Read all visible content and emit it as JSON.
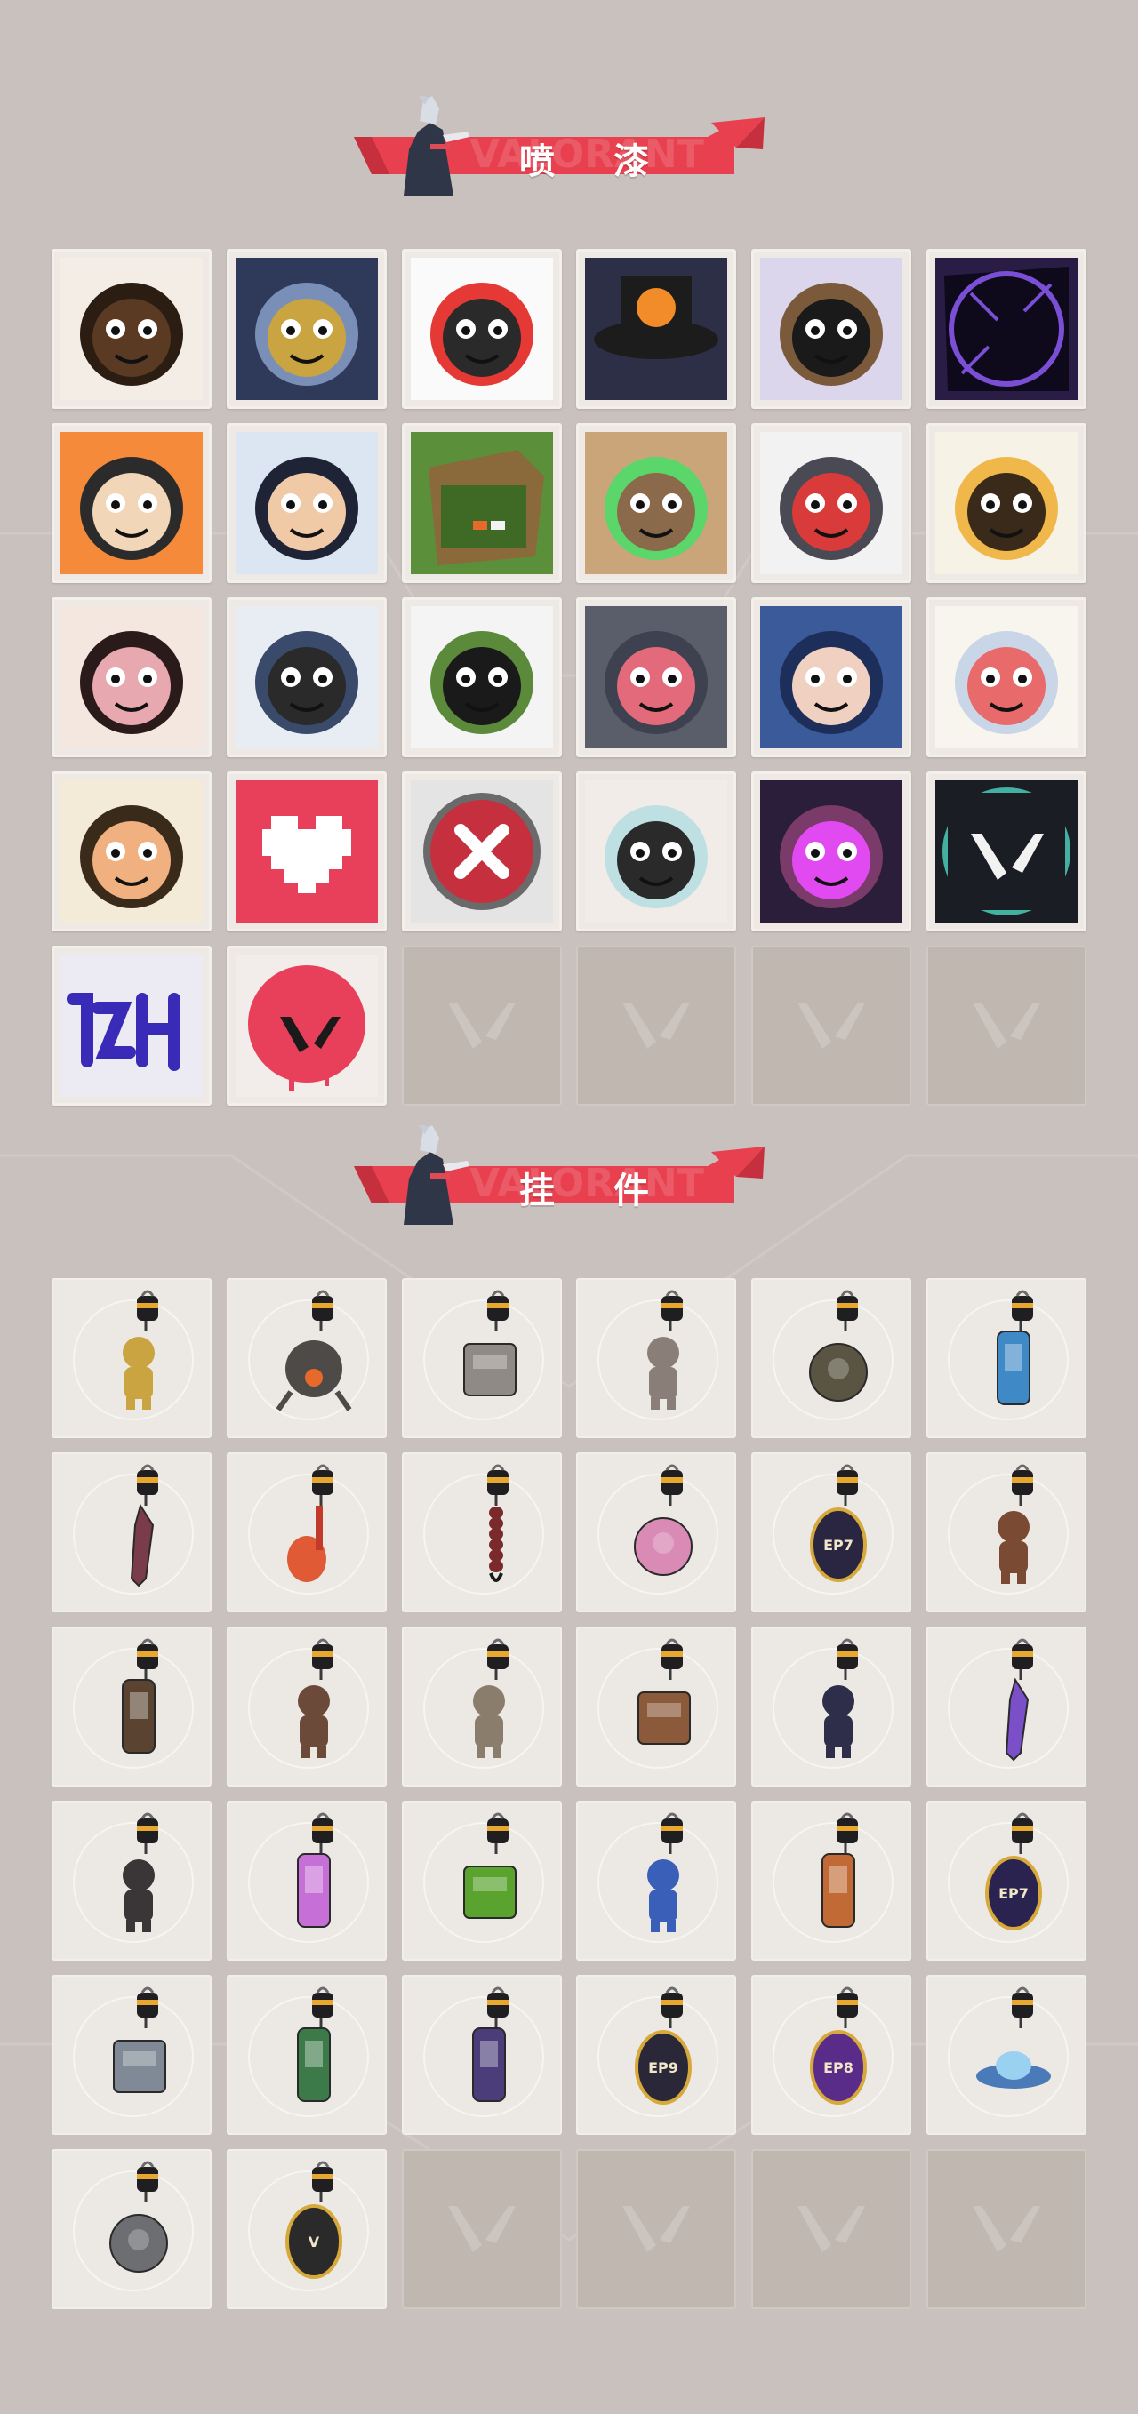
{
  "sections": {
    "sprays": {
      "title": "喷 漆"
    },
    "buddies": {
      "title": "挂 件"
    }
  },
  "banner": {
    "watermark": "VALORANT",
    "accent_color": "#e8404f",
    "accent_dark": "#c62f3e"
  },
  "sprays": [
    {
      "name": "pixel-mohawk-agent-spray",
      "kind": "spray"
    },
    {
      "name": "helmet-robot-spray",
      "kind": "spray"
    },
    {
      "name": "clown-face-spray",
      "kind": "spray"
    },
    {
      "name": "top-hat-spray",
      "kind": "spray"
    },
    {
      "name": "sunglasses-raccoon-spray",
      "kind": "spray"
    },
    {
      "name": "dark-portal-spray",
      "kind": "spray"
    },
    {
      "name": "grinning-bearded-agent-spray",
      "kind": "spray"
    },
    {
      "name": "bandaged-boy-spray",
      "kind": "spray"
    },
    {
      "name": "green-crate-spray",
      "kind": "spray"
    },
    {
      "name": "glowing-eyes-creature-spray",
      "kind": "spray"
    },
    {
      "name": "crying-seal-spray",
      "kind": "spray"
    },
    {
      "name": "laughing-tiger-spray",
      "kind": "spray"
    },
    {
      "name": "angry-girl-pencil-spray",
      "kind": "spray"
    },
    {
      "name": "beanie-penguin-spray",
      "kind": "spray"
    },
    {
      "name": "top-hat-frog-spray",
      "kind": "spray"
    },
    {
      "name": "smiling-cat-spray",
      "kind": "spray"
    },
    {
      "name": "hooded-agent-spray",
      "kind": "spray"
    },
    {
      "name": "sleeping-elder-spray",
      "kind": "spray"
    },
    {
      "name": "shocked-glasses-agent-spray",
      "kind": "spray"
    },
    {
      "name": "pixel-heart-spray",
      "kind": "spray"
    },
    {
      "name": "red-x-button-spray",
      "kind": "spray"
    },
    {
      "name": "white-haired-girl-spray",
      "kind": "spray"
    },
    {
      "name": "evil-grin-agent-spray",
      "kind": "spray"
    },
    {
      "name": "valorant-logo-splash-spray",
      "kind": "spray"
    },
    {
      "name": "purple-graffiti-tag-spray",
      "kind": "spray"
    },
    {
      "name": "red-dripping-logo-spray",
      "kind": "spray"
    },
    {
      "name": "empty-slot",
      "kind": "empty"
    },
    {
      "name": "empty-slot",
      "kind": "empty"
    },
    {
      "name": "empty-slot",
      "kind": "empty"
    },
    {
      "name": "empty-slot",
      "kind": "empty"
    }
  ],
  "buddies": [
    {
      "name": "golden-cat-buddy",
      "color": "#c9a441",
      "shape": "figure"
    },
    {
      "name": "robot-drone-buddy",
      "color": "#4d4a47",
      "shape": "drone"
    },
    {
      "name": "cat-in-tub-buddy",
      "color": "#8f8a86",
      "shape": "box"
    },
    {
      "name": "raccoon-figure-buddy",
      "color": "#8a7f78",
      "shape": "figure"
    },
    {
      "name": "round-pouch-buddy",
      "color": "#5a5442",
      "shape": "round"
    },
    {
      "name": "blue-lantern-buddy",
      "color": "#3f89c7",
      "shape": "tall"
    },
    {
      "name": "spiked-blade-buddy",
      "color": "#7a3b4a",
      "shape": "blade"
    },
    {
      "name": "red-guitar-buddy",
      "color": "#e05a36",
      "shape": "guitar"
    },
    {
      "name": "braided-cord-buddy",
      "color": "#7a2a2a",
      "shape": "cord"
    },
    {
      "name": "pink-cupcake-buddy",
      "color": "#d98ab5",
      "shape": "round"
    },
    {
      "name": "ep7-act-token-buddy",
      "color": "#2a2540",
      "shape": "token",
      "label": "EP7"
    },
    {
      "name": "boxing-bear-buddy",
      "color": "#7a4a32",
      "shape": "figure"
    },
    {
      "name": "leather-holster-buddy",
      "color": "#5a4330",
      "shape": "tall"
    },
    {
      "name": "agent-figurine-buddy",
      "color": "#6b4a3a",
      "shape": "figure"
    },
    {
      "name": "cowboy-figure-buddy",
      "color": "#8b7d6b",
      "shape": "figure"
    },
    {
      "name": "brown-satchel-buddy",
      "color": "#8a5a3a",
      "shape": "box"
    },
    {
      "name": "tasseled-figure-buddy",
      "color": "#2e2e4a",
      "shape": "figure"
    },
    {
      "name": "purple-crystal-buddy",
      "color": "#7b4fc7",
      "shape": "blade"
    },
    {
      "name": "dark-creature-buddy",
      "color": "#3a3536",
      "shape": "figure"
    },
    {
      "name": "lava-lamp-buddy",
      "color": "#c66fd6",
      "shape": "tall"
    },
    {
      "name": "green-pager-buddy",
      "color": "#5aa32e",
      "shape": "box"
    },
    {
      "name": "astronaut-buddy",
      "color": "#3a5fb8",
      "shape": "figure"
    },
    {
      "name": "radio-device-buddy",
      "color": "#c26a35",
      "shape": "tall"
    },
    {
      "name": "ep7-medal-buddy",
      "color": "#2a2350",
      "shape": "token",
      "label": "EP7"
    },
    {
      "name": "agent-card-buddy",
      "color": "#7f8a96",
      "shape": "box"
    },
    {
      "name": "green-can-buddy",
      "color": "#3c7a4a",
      "shape": "tall"
    },
    {
      "name": "purple-capsule-buddy",
      "color": "#4a3d7a",
      "shape": "tall"
    },
    {
      "name": "ep9-act-token-buddy",
      "color": "#2a2838",
      "shape": "token",
      "label": "EP9"
    },
    {
      "name": "ep8-act-token-buddy",
      "color": "#5a2c8a",
      "shape": "token",
      "label": "EP8"
    },
    {
      "name": "ufo-buddy",
      "color": "#4a7ab8",
      "shape": "ufo"
    },
    {
      "name": "grey-cat-pouch-buddy",
      "color": "#6d6e72",
      "shape": "round"
    },
    {
      "name": "valorant-emblem-buddy",
      "color": "#2a2a2a",
      "shape": "token",
      "label": "V"
    },
    {
      "name": "empty-slot",
      "shape": "empty"
    },
    {
      "name": "empty-slot",
      "shape": "empty"
    },
    {
      "name": "empty-slot",
      "shape": "empty"
    },
    {
      "name": "empty-slot",
      "shape": "empty"
    }
  ]
}
